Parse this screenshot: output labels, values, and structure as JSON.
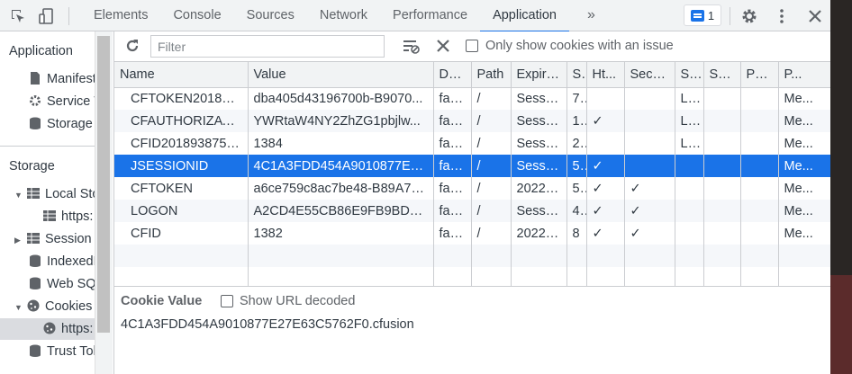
{
  "tabs": [
    "Elements",
    "Console",
    "Sources",
    "Network",
    "Performance",
    "Application"
  ],
  "issues_count": "1",
  "sidebar": {
    "application_title": "Application",
    "app_items": [
      "Manifest",
      "Service Workers",
      "Storage"
    ],
    "storage_title": "Storage",
    "storage_items": [
      "Local Storage",
      "https:",
      "Session Storage",
      "IndexedDB",
      "Web SQL",
      "Cookies",
      "https:",
      "Trust Tokens"
    ]
  },
  "toolbar": {
    "filter_placeholder": "Filter",
    "only_issue_label": "Only show cookies with an issue"
  },
  "columns": [
    "Name",
    "Value",
    "Do...",
    "Path",
    "Expire...",
    "S",
    "Ht...",
    "Secu...",
    "S...",
    "Sa...",
    "Pa...",
    "P..."
  ],
  "rows": [
    [
      "CFTOKEN201893...",
      "dba405d43196700b-B9070...",
      "fac...",
      "/",
      "Session",
      "7...",
      "",
      "",
      "L...",
      "",
      "",
      "Me..."
    ],
    [
      "CFAUTHORIZATI...",
      "YWRtaW4NY2ZhZG1pbjlw...",
      "fac...",
      "/",
      "Session",
      "1...",
      "✓",
      "",
      "L...",
      "",
      "",
      "Me..."
    ],
    [
      "CFID2018938756...",
      "1384",
      "fac...",
      "/",
      "Session",
      "2...",
      "",
      "",
      "L...",
      "",
      "",
      "Me..."
    ],
    [
      "JSESSIONID",
      "4C1A3FDD454A9010877E2...",
      "fac...",
      "/",
      "Session",
      "5...",
      "✓",
      "",
      "",
      "",
      "",
      "Me..."
    ],
    [
      "CFTOKEN",
      "a6ce759c8ac7be48-B89A71...",
      "fac...",
      "/",
      "2022-...",
      "5...",
      "✓",
      "✓",
      "",
      "",
      "",
      "Me..."
    ],
    [
      "LOGON",
      "A2CD4E55CB86E9FB9BD58...",
      "fac...",
      "/",
      "Session",
      "4...",
      "✓",
      "✓",
      "",
      "",
      "",
      "Me..."
    ],
    [
      "CFID",
      "1382",
      "fac...",
      "/",
      "2022-...",
      "8",
      "✓",
      "✓",
      "",
      "",
      "",
      "Me..."
    ]
  ],
  "cookie_value": {
    "title": "Cookie Value",
    "decode_label": "Show URL decoded",
    "value": "4C1A3FDD454A9010877E27E63C5762F0.cfusion"
  }
}
